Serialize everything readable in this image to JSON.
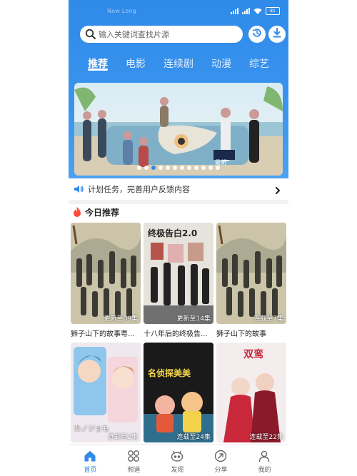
{
  "status_bar": {
    "carrier": "Now Long",
    "battery": "81"
  },
  "search": {
    "placeholder": "输入关键词查找片源"
  },
  "tabs": [
    {
      "label": "推荐"
    },
    {
      "label": "电影"
    },
    {
      "label": "连续剧"
    },
    {
      "label": "动漫"
    },
    {
      "label": "综艺"
    }
  ],
  "banner": {
    "tag": "最新",
    "page_count": 13,
    "current_page": 3
  },
  "notice": {
    "text": "计划任务，完善用户反馈内容"
  },
  "section": {
    "title": "今日推荐"
  },
  "cards": [
    {
      "title": "狮子山下的故事粤...",
      "badge": "更新至09集",
      "poster_text": ""
    },
    {
      "title": "十八年后的终极告...",
      "badge": "更新至14集",
      "poster_text": "终极告白2.0"
    },
    {
      "title": "狮子山下的故事",
      "badge": "连载至7集",
      "poster_text": ""
    },
    {
      "title": "",
      "badge": "连载至2集",
      "poster_text": "カノジョも"
    },
    {
      "title": "",
      "badge": "连载至24集",
      "poster_text": "名侦探美美"
    },
    {
      "title": "",
      "badge": "连载至22集",
      "poster_text": "双鸾"
    }
  ],
  "bottom_nav": [
    {
      "label": "首页",
      "icon": "home-icon"
    },
    {
      "label": "频道",
      "icon": "channels-icon"
    },
    {
      "label": "发现",
      "icon": "discover-icon"
    },
    {
      "label": "分享",
      "icon": "share-icon"
    },
    {
      "label": "我的",
      "icon": "profile-icon"
    }
  ],
  "colors": {
    "accent": "#2f8ae8",
    "header_bg": "#3a94ef",
    "hot": "#ff4a3a"
  }
}
